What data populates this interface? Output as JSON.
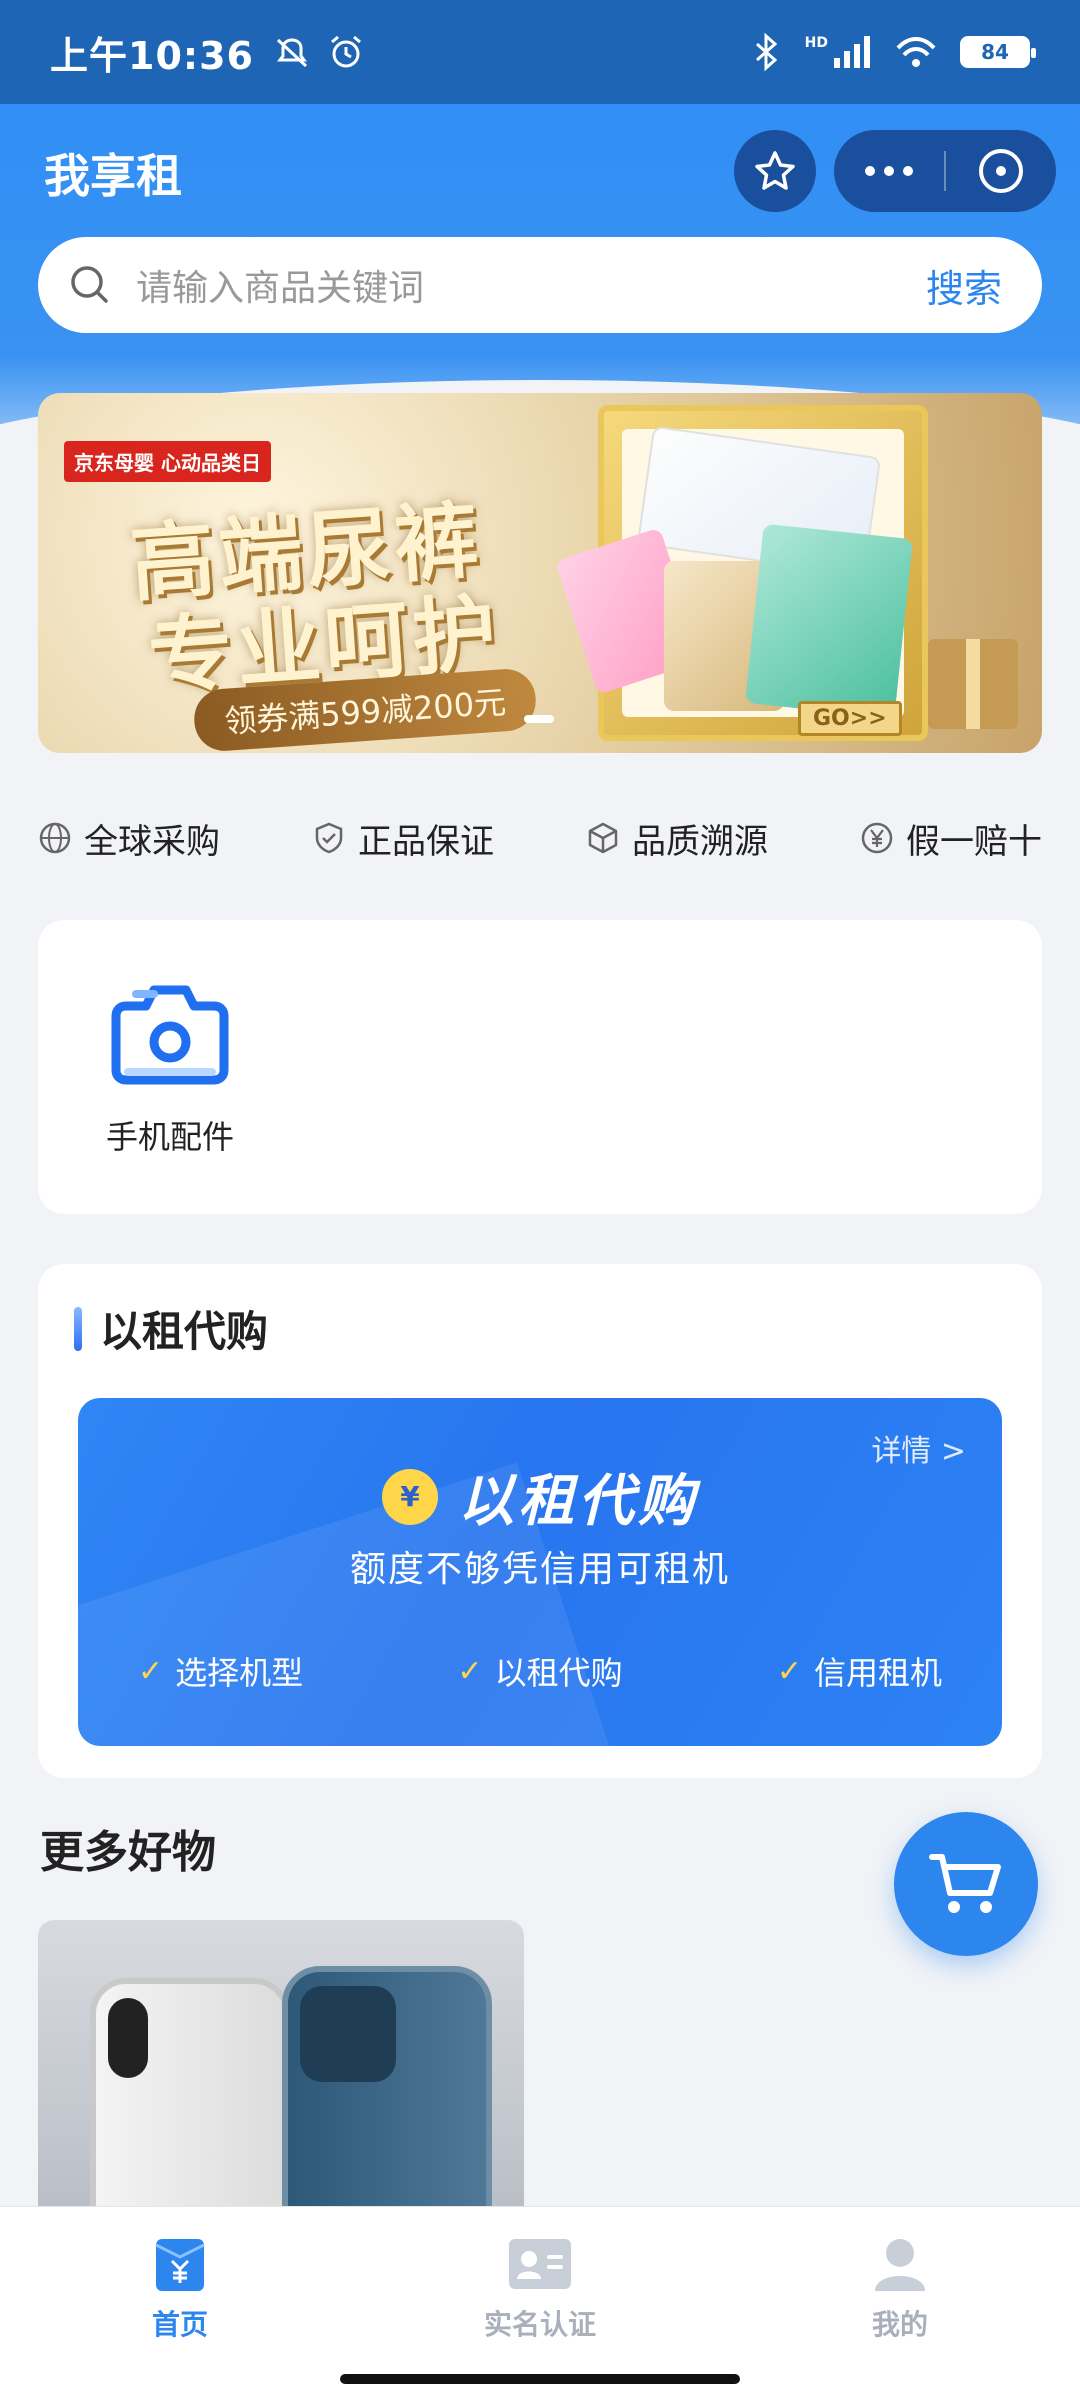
{
  "status_bar": {
    "time": "上午10:36",
    "battery": "84",
    "network": "HD"
  },
  "header": {
    "title": "我享租"
  },
  "search": {
    "placeholder": "请输入商品关键词",
    "button": "搜索"
  },
  "banner": {
    "tag": "京东母婴 心动品类日",
    "headline_line1": "高端尿裤",
    "headline_line2": "专业呵护",
    "coupon": "领券满599减200元",
    "cta": "GO>>"
  },
  "assurances": [
    {
      "icon": "globe-icon",
      "label": "全球采购"
    },
    {
      "icon": "shield-check-icon",
      "label": "正品保证"
    },
    {
      "icon": "cube-icon",
      "label": "品质溯源"
    },
    {
      "icon": "yen-coin-icon",
      "label": "假一赔十"
    }
  ],
  "categories": [
    {
      "icon": "camera-icon",
      "label": "手机配件"
    }
  ],
  "rent_to_buy": {
    "section_title": "以租代购",
    "detail": "详情 >",
    "brand_name": "以租代购",
    "coin_symbol": "¥",
    "subtitle": "额度不够凭信用可租机",
    "steps": [
      "选择机型",
      "以租代购",
      "信用租机"
    ]
  },
  "more_goods": {
    "title": "更多好物"
  },
  "tabs": [
    {
      "label": "首页",
      "icon": "home-yen-icon",
      "active": true
    },
    {
      "label": "实名认证",
      "icon": "id-card-icon",
      "active": false
    },
    {
      "label": "我的",
      "icon": "user-icon",
      "active": false
    }
  ],
  "colors": {
    "primary": "#2c86ee",
    "status_bar": "#1f65b5",
    "page_bg": "#f1f3f7"
  }
}
